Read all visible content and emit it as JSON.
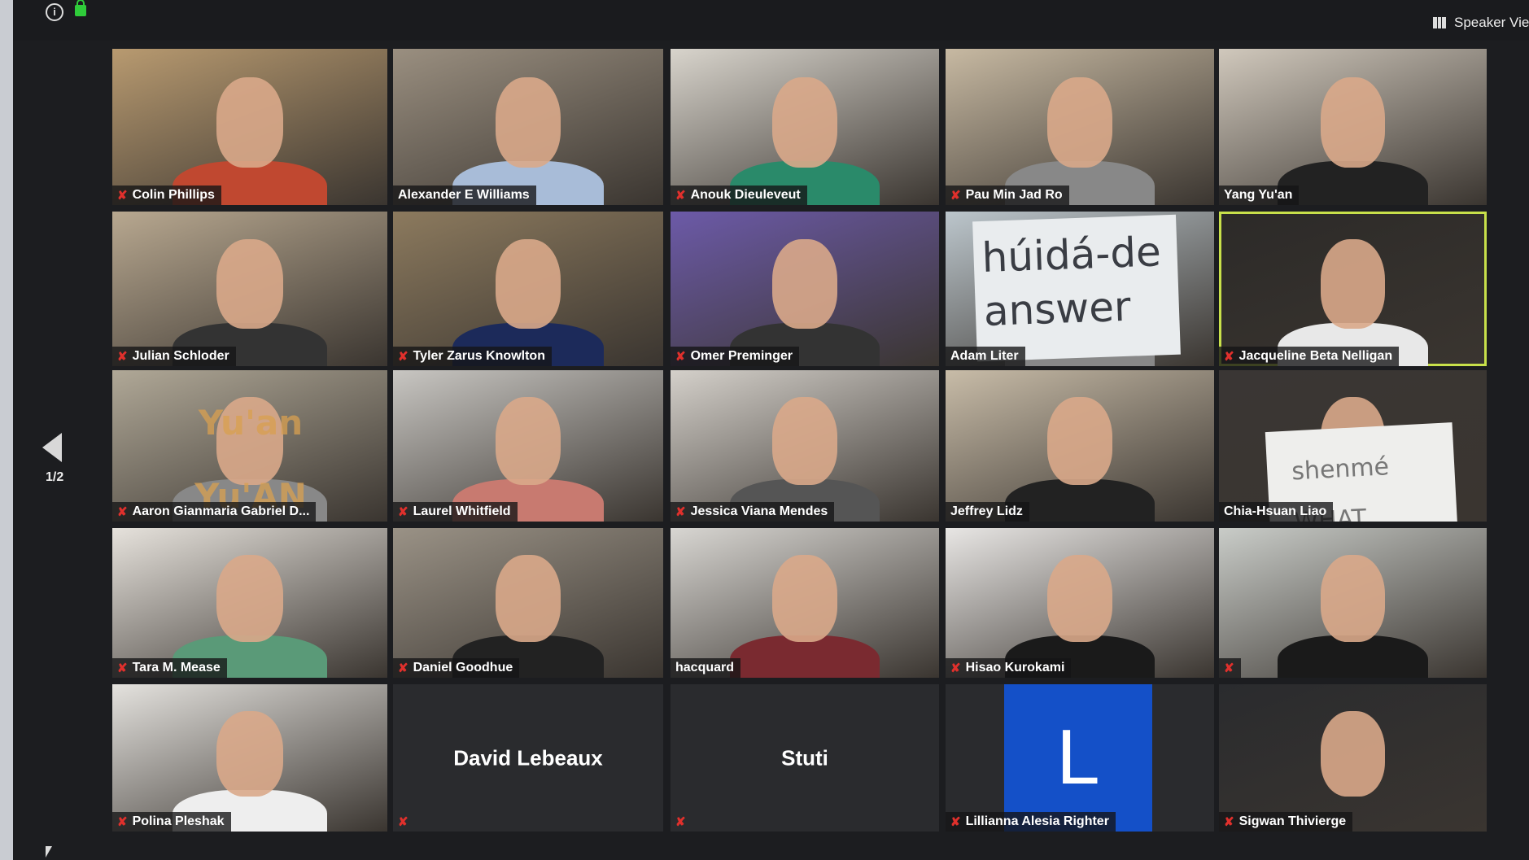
{
  "toolbar": {
    "info_icon": "info-icon",
    "lock_icon": "lock-icon",
    "speaker_view_label": "Speaker View",
    "accent": "#2fcc3a"
  },
  "pagination": {
    "page": "1/2"
  },
  "colors": {
    "active_speaker": "#c8e04a",
    "muted": "#e0302c",
    "avatar_blue": "#1450c8"
  },
  "participants": [
    {
      "name": "Colin Phillips",
      "muted": true
    },
    {
      "name": "Alexander E Williams",
      "muted": false
    },
    {
      "name": "Anouk Dieuleveut",
      "muted": true
    },
    {
      "name": "Pau Min Jad Ro",
      "muted": true
    },
    {
      "name": "Yang Yu'an",
      "muted": false
    },
    {
      "name": "Julian Schloder",
      "muted": true
    },
    {
      "name": "Tyler Zarus Knowlton",
      "muted": true
    },
    {
      "name": "Omer Preminger",
      "muted": true
    },
    {
      "name": "Adam Liter",
      "muted": false
    },
    {
      "name": "Jacqueline Beta Nelligan",
      "muted": true,
      "active_speaker": true
    },
    {
      "name": "Aaron Gianmaria Gabriel D...",
      "muted": true
    },
    {
      "name": "Laurel Whitfield",
      "muted": true
    },
    {
      "name": "Jessica Viana Mendes",
      "muted": true
    },
    {
      "name": "Jeffrey Lidz",
      "muted": false
    },
    {
      "name": "Chia-Hsuan Liao",
      "muted": false
    },
    {
      "name": "Tara M. Mease",
      "muted": true
    },
    {
      "name": "Daniel Goodhue",
      "muted": true
    },
    {
      "name": "hacquard",
      "muted": false
    },
    {
      "name": "Hisao Kurokami",
      "muted": true
    },
    {
      "name": "",
      "muted": true
    },
    {
      "name": "Polina Pleshak",
      "muted": true
    },
    {
      "name": "David Lebeaux",
      "muted": true,
      "video_off": true
    },
    {
      "name": "Stuti",
      "muted": true,
      "video_off": true
    },
    {
      "name": "Lillianna Alesia Righter",
      "muted": true,
      "avatar_letter": "L"
    },
    {
      "name": "Sigwan Thivierge",
      "muted": true
    }
  ],
  "signs": {
    "adam": "húidá-de answer",
    "chia": "shenmé WHAT",
    "aaron": "Yu'an Yu'AN"
  }
}
